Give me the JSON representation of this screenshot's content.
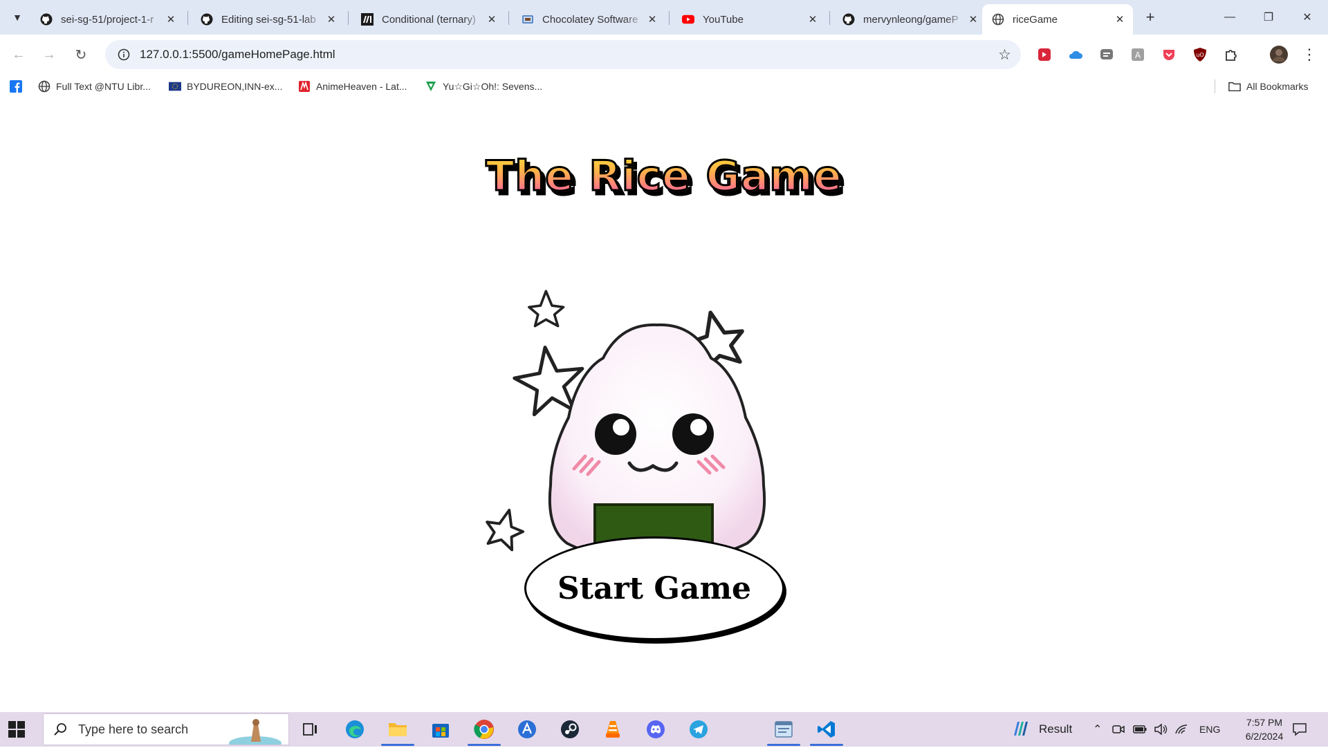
{
  "tabs": [
    {
      "title": "sei-sg-51/project-1-r",
      "icon": "github-icon"
    },
    {
      "title": "Editing sei-sg-51-lab",
      "icon": "github-icon"
    },
    {
      "title": "Conditional (ternary)",
      "icon": "mdn-icon"
    },
    {
      "title": "Chocolatey Software",
      "icon": "chocolatey-icon"
    },
    {
      "title": "YouTube",
      "icon": "youtube-icon"
    },
    {
      "title": "mervynleong/gameP",
      "icon": "github-icon"
    },
    {
      "title": "riceGame",
      "icon": "globe-icon"
    }
  ],
  "active_tab_index": 6,
  "address_bar": {
    "url": "127.0.0.1:5500/gameHomePage.html"
  },
  "bookmarks": [
    {
      "label": "",
      "icon": "facebook-icon"
    },
    {
      "label": "Full Text @NTU Libr...",
      "icon": "globe-icon"
    },
    {
      "label": "BYDUREON,INN-ex...",
      "icon": "eu-flag-icon"
    },
    {
      "label": "AnimeHeaven - Lat...",
      "icon": "animeheaven-icon"
    },
    {
      "label": "Yu☆Gi☆Oh!: Sevens...",
      "icon": "yugioh-icon"
    }
  ],
  "all_bookmarks_label": "All Bookmarks",
  "page": {
    "title": "The Rice Game",
    "start_button": "Start Game",
    "mascot": "onigiri-mascot-icon"
  },
  "taskbar": {
    "search_placeholder": "Type here to search",
    "weather_label": "Result",
    "language": "ENG",
    "time": "7:57 PM",
    "date": "6/2/2024"
  },
  "colors": {
    "tabstrip": "#dfe7f5",
    "title_gradient_top": "#ffe033",
    "title_gradient_bottom": "#ff4fb3",
    "nori": "#2f5a14",
    "taskbar": "#e3d9ea"
  }
}
